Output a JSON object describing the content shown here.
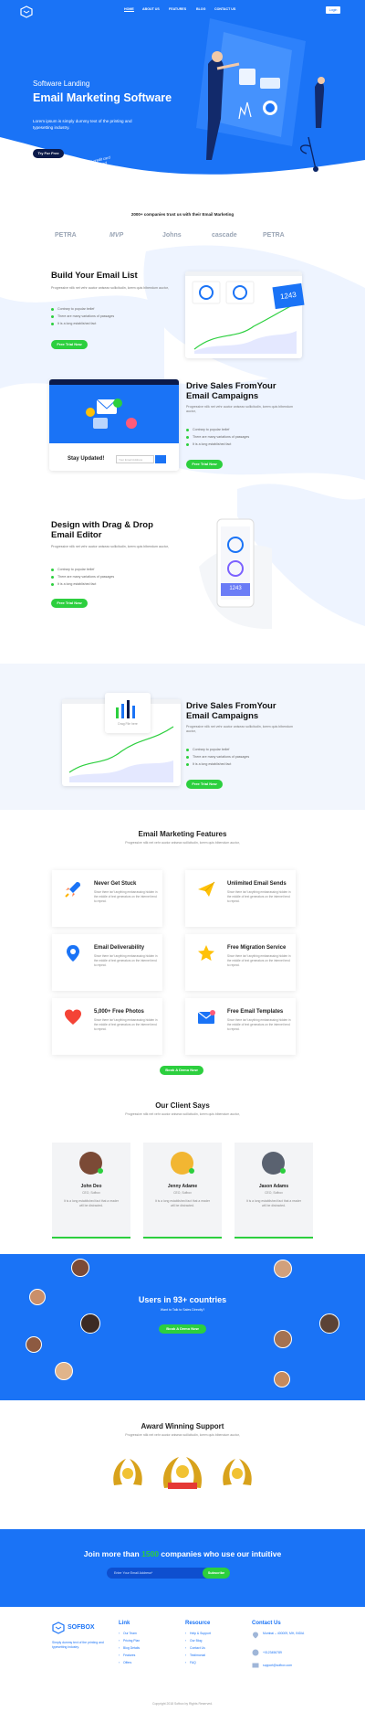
{
  "nav": {
    "items": [
      "HOME",
      "ABOUT US",
      "FEATURES",
      "BLOG",
      "CONTACT US"
    ],
    "login": "Login"
  },
  "hero": {
    "eyebrow": "Software Landing",
    "title": "Email Marketing Software",
    "desc": "Lorem ipsum is simply dummy text of the printing and typesetting industry.",
    "cta": "Try For Free",
    "note": "No credit card required"
  },
  "trust": {
    "title": "2000+ companies trust us with their Email Marketing",
    "logos": [
      "PETRA",
      "MVP",
      "Johns",
      "cascade",
      "PETRA"
    ]
  },
  "s1": {
    "title": "Build Your Email List",
    "desc": "Progressive rdlk net vehr auctor aniseax sollicitudin, lorem quis bibendum auctor,",
    "bullets": [
      "Contrary to popular belief",
      "There are many variations of passages",
      "It is a long established fact"
    ],
    "cta": "Free Trial Now",
    "stat": "1243"
  },
  "s2": {
    "title": "Drive Sales FromYour Email Campaigns",
    "desc": "Progressive rdlk net vehr auctor aniseax sollicitudin, lorem quis bibendum auctor,",
    "bullets": [
      "Contrary to popular belief",
      "There are many variations of passages",
      "It is a long established fact"
    ],
    "cta": "Free Trial Now",
    "stay": "Stay Updated!",
    "email_ph": "Your Email Address"
  },
  "s3": {
    "title": "Design with Drag & Drop Email Editor",
    "desc": "Progressive rdlk net vehr auctor aniseax sollicitudin, lorem quis bibendum auctor,",
    "bullets": [
      "Contrary to popular belief",
      "There are many variations of passages",
      "It is a long established fact"
    ],
    "cta": "Free Trial Now",
    "stat": "1243"
  },
  "s4": {
    "title": "Drive Sales FromYour Email Campaigns",
    "desc": "Progressive rdlk net vehr auctor aniseax sollicitudin, lorem quis bibendum auctor,",
    "bullets": [
      "Contrary to popular belief",
      "There are many variations of passages",
      "It is a long established fact"
    ],
    "cta": "Free Trial Now",
    "drag": "Drag File here"
  },
  "features": {
    "title": "Email Marketing Features",
    "sub": "Progressive rdlk net vehr auctor aniseax sollicitudin, lorem quis bibendum auctor,",
    "items": [
      {
        "title": "Never Get Stuck",
        "icon": "rocket-icon"
      },
      {
        "title": "Unlimited Email Sends",
        "icon": "paper-plane-icon"
      },
      {
        "title": "Email Deliverability",
        "icon": "map-pin-icon"
      },
      {
        "title": "Free Migration Service",
        "icon": "star-icon"
      },
      {
        "title": "5,000+ Free Photos",
        "icon": "heart-icon"
      },
      {
        "title": "Free Email Templates",
        "icon": "envelope-icon"
      }
    ],
    "desc": "Since there isn't anything embarrassing hidden in the middle of text generators on the internet tend to repeat.",
    "cta": "Book A Demo Now"
  },
  "clients": {
    "title": "Our Client Says",
    "sub": "Progressive rdlk net vehr auctor aniseax sollicitudin, lorem quis bibendum auctor,",
    "items": [
      {
        "name": "John Deo",
        "role": "CEO, Sofbox"
      },
      {
        "name": "Jenny Adame",
        "role": "CEO, Sofbox"
      },
      {
        "name": "Jason Adams",
        "role": "CEO, Sofbox"
      }
    ],
    "quote": "It is a long established fact that a reader will be distracted."
  },
  "users": {
    "title": "Users in 93+ countries",
    "sub": "Want to Talk to Sales Directly?",
    "cta": "Book A Demo Now"
  },
  "award": {
    "title": "Award Winning Support",
    "sub": "Progressive rdlk net vehr auctor aniseax sollicitudin, lorem quis bibendum auctor,"
  },
  "join": {
    "pre": "Join more than",
    "num": "1500",
    "post": "companies who use our intuitive",
    "ph": "Enter Your Email Address*",
    "btn": "Subscribe"
  },
  "footer": {
    "brand": "SOFBOX",
    "about": "Simply dummy text of the printing and typesetting industry.",
    "link_h": "Link",
    "links": [
      "Our Team",
      "Pricing Plan",
      "Blog Details",
      "Features",
      "Offers"
    ],
    "res_h": "Resource",
    "resources": [
      "Help & Support",
      "Our Blog",
      "Contact Us",
      "Testimonial",
      "FAQ"
    ],
    "contact_h": "Contact Us",
    "address": "Mumbai – 400009, MH, INDIA",
    "phone": "+0123456789",
    "email": "support@sofbox.com",
    "copyright": "Copyright 2018 Sofbox by Rights Reserved."
  },
  "colors": {
    "primary": "#1a73f6",
    "accent": "#2ccf3e"
  }
}
